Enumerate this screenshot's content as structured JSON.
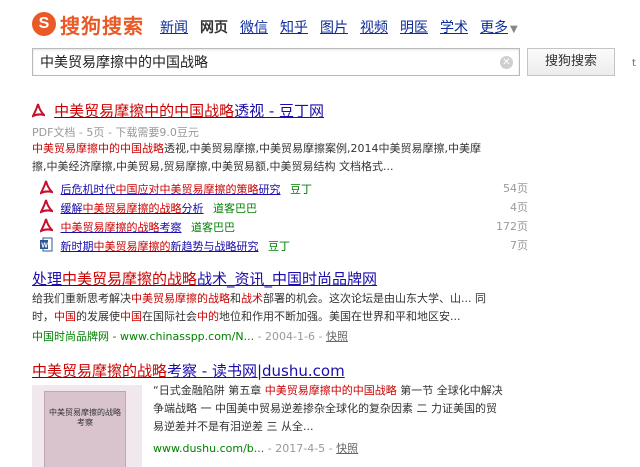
{
  "header": {
    "logo_glyph": "S",
    "logo_text": "搜狗搜索",
    "nav": [
      "新闻",
      "网页",
      "微信",
      "知乎",
      "图片",
      "视频",
      "明医",
      "学术"
    ],
    "active_tab": "网页",
    "more": "更多"
  },
  "search": {
    "query": "中美贸易摩擦中的中国战略",
    "button": "搜狗搜索",
    "side_char": "t"
  },
  "results": [
    {
      "title_pre": "",
      "title_em": "中美贸易摩擦中的中国战略",
      "title_post": "透视 - 豆丁网",
      "meta": "PDF文档 - 5页 - 下载需要9.0豆元",
      "snippet_em1": "中美贸易摩擦中的中国战略",
      "snippet_1": "透视,中美贸易摩擦,中美贸易摩擦案例,2014中美贸易摩擦,中美摩",
      "snippet_2": "擦,中美经济摩擦,中美贸易,贸易摩擦,中美贸易额,中美贸易结构 文档格式...",
      "subs": [
        {
          "icon": "pdf",
          "pre": "后危机时代",
          "em": "中国应对中美贸易摩擦的策略",
          "post": "研究",
          "src": "豆丁",
          "pages": "54页"
        },
        {
          "icon": "pdf",
          "pre": "缓解",
          "em": "中美贸易摩擦的战略",
          "post": "分析",
          "src": "道客巴巴",
          "pages": "4页"
        },
        {
          "icon": "pdf",
          "pre": "",
          "em": "中美贸易摩擦的战略",
          "post": "考察",
          "src": "道客巴巴",
          "pages": "172页"
        },
        {
          "icon": "word",
          "pre": "新时期",
          "em": "中美贸易摩擦的",
          "post": "新趋势与战略研究",
          "src": "豆丁",
          "pages": "7页"
        }
      ]
    },
    {
      "title_pre": "处理",
      "title_em": "中美贸易摩擦的战略",
      "title_post": "战术_资讯_中国时尚品牌网",
      "snippet_a_pre": "给我们重新思考解决",
      "snippet_a_em": "中美贸易摩擦的战略",
      "snippet_a_mid": "和",
      "snippet_a_em2": "战术",
      "snippet_a_post": "部署的机会。这次论坛是由山东大学、山... 同",
      "snippet_b_pre": "时，",
      "snippet_b_em": "中国",
      "snippet_b_mid": "的发展使",
      "snippet_b_em2": "中国",
      "snippet_b_mid2": "在国际社会",
      "snippet_b_em3": "中的",
      "snippet_b_post": "地位和作用不断加强。美国在世界和平和地区安...",
      "url": "中国时尚品牌网 - www.chinasspp.com/N...",
      "date": "2004-1-6",
      "kuaizhao": "快照"
    },
    {
      "title_em": "中美贸易摩擦的战略",
      "title_post": "考察 - 读书网|dushu.com",
      "snippet_1_pre": "“日式金融陷阱 第五章 ",
      "snippet_1_em": "中美贸易摩擦中的中国战略",
      "snippet_1_post": " 第一节 全球化中解决",
      "snippet_2": "争端战略 一 中国美中贸易逆差掺杂全球化的复杂因素 二 力证美国的贸",
      "snippet_3": "易逆差并不是有泪逆差 三 从全...",
      "url": "www.dushu.com/b...",
      "date": "2017-4-5",
      "kuaizhao": "快照",
      "thumb_text": "中美贸易摩擦的战略考察"
    }
  ],
  "colors": {
    "brand": "#ea5a26",
    "link": "#1a0dab",
    "em": "#cc0000",
    "url": "#008000"
  }
}
